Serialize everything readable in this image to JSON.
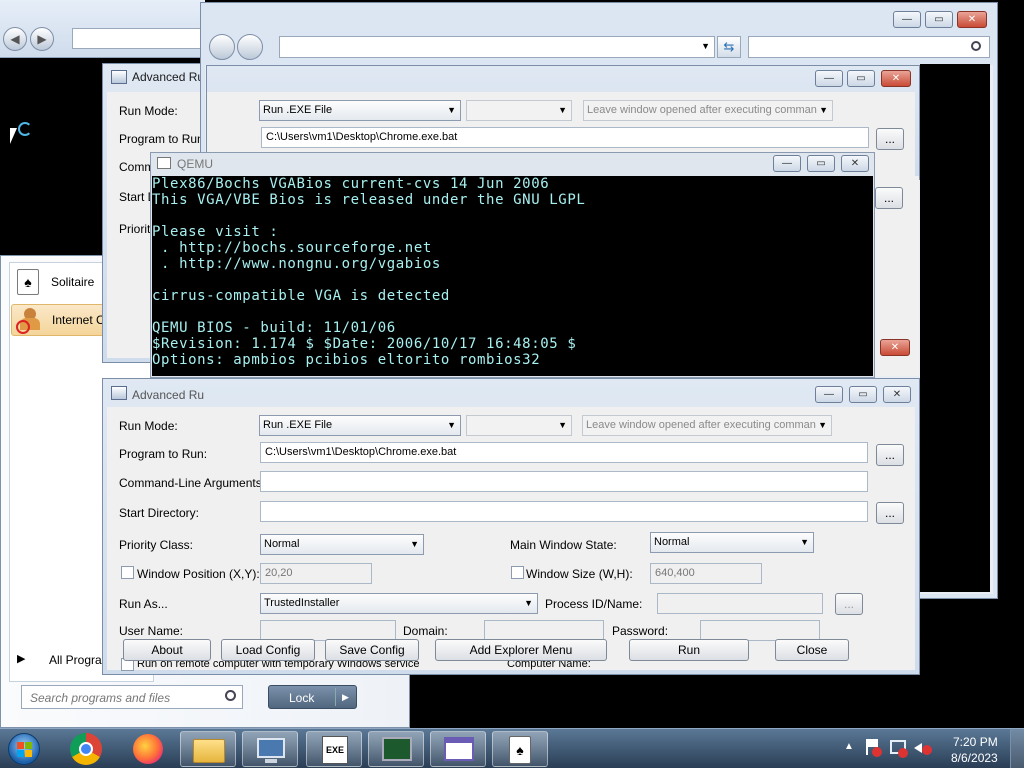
{
  "browser_bg": {
    "back_icon": "back-arrow-icon",
    "forward_icon": "forward-arrow-icon"
  },
  "explorer": {
    "search_icon": "search-icon",
    "refresh_icon": "refresh-icon",
    "controls": {
      "minimize": "—",
      "maximize": "▭",
      "close": "✕"
    }
  },
  "start_menu": {
    "items": [
      {
        "label": "Solitaire",
        "icon": "solitaire-icon"
      },
      {
        "label": "Internet Checkers",
        "icon": "checkers-icon"
      }
    ],
    "all_programs": "All Progra",
    "search_placeholder": "Search programs and files",
    "lock_label": "Lock"
  },
  "advrun_back": {
    "title": "Advanced Ru",
    "run_mode_label": "Run Mode:",
    "run_mode_value": "Run .EXE File",
    "leave_window": "Leave window opened after executing comman",
    "program_label": "Program to Run:",
    "program_value": "C:\\Users\\vm1\\Desktop\\Chrome.exe.bat",
    "cmd_label": "Comma",
    "start_label": "Start D",
    "priority_label": "Priorit",
    "browse": "..."
  },
  "qemu": {
    "title": "QEMU",
    "lines": [
      "Plex86/Bochs VGABios current-cvs 14 Jun 2006",
      "This VGA/VBE Bios is released under the GNU LGPL",
      "",
      "Please visit :",
      " . http://bochs.sourceforge.net",
      " . http://www.nongnu.org/vgabios",
      "",
      "cirrus-compatible VGA is detected",
      "",
      "QEMU BIOS - build: 11/01/06",
      "$Revision: 1.174 $ $Date: 2006/10/17 16:48:05 $",
      "Options: apmbios pcibios eltorito rombios32"
    ]
  },
  "advrun_front": {
    "title": "Advanced Ru",
    "run_mode_label": "Run Mode:",
    "run_mode_value": "Run .EXE File",
    "leave_window": "Leave window opened after executing comman",
    "program_label": "Program to Run:",
    "program_value": "C:\\Users\\vm1\\Desktop\\Chrome.exe.bat",
    "cmdline_label": "Command-Line Arguments:",
    "startdir_label": "Start Directory:",
    "priority_label": "Priority Class:",
    "priority_value": "Normal",
    "mainwin_label": "Main Window State:",
    "mainwin_value": "Normal",
    "winpos_label": "Window Position (X,Y):",
    "winpos_value": "20,20",
    "winsize_label": "Window Size (W,H):",
    "winsize_value": "640,400",
    "runas_label": "Run As...",
    "runas_value": "TrustedInstaller",
    "processid_label": "Process ID/Name:",
    "username_label": "User Name:",
    "domain_label": "Domain:",
    "password_label": "Password:",
    "remote_label": "Run on remote computer with temporary Windows service",
    "computer_label": "Computer Name:",
    "browse": "...",
    "buttons": {
      "about": "About",
      "load": "Load Config",
      "save": "Save Config",
      "explorer_menu": "Add Explorer Menu",
      "run": "Run",
      "close": "Close"
    }
  },
  "taskbar": {
    "time": "7:20 PM",
    "date": "8/6/2023",
    "apps": [
      "start-orb",
      "chrome",
      "firefox",
      "file-explorer",
      "computer",
      "advanced-run",
      "network-monitor",
      "qemu",
      "solitaire"
    ]
  },
  "colors": {
    "terminal_text": "#a8f0f0",
    "taskbar": "#3b5672",
    "close_button": "#c94b36"
  }
}
